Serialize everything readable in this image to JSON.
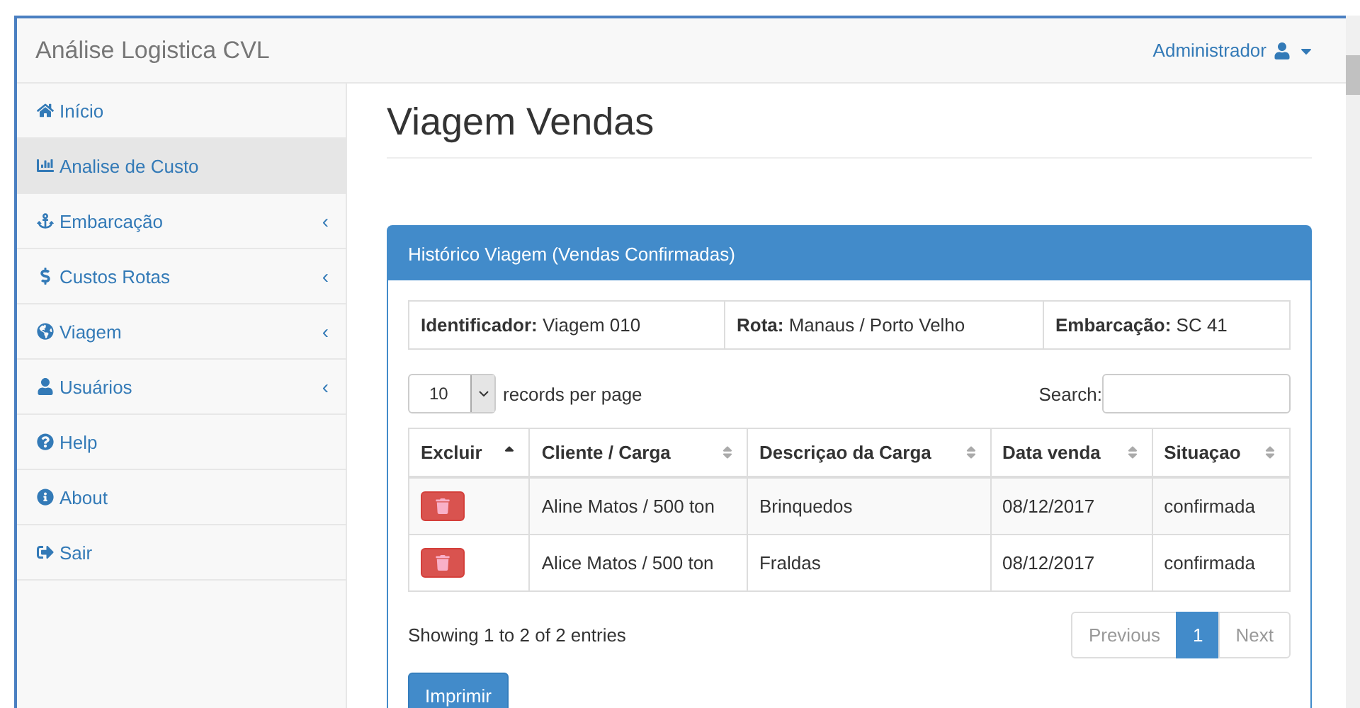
{
  "navbar": {
    "brand": "Análise Logistica CVL",
    "user": "Administrador"
  },
  "sidebar": {
    "items": [
      {
        "label": "Início",
        "selected": false
      },
      {
        "label": "Analise de Custo",
        "selected": true
      },
      {
        "label": "Embarcação",
        "selected": false,
        "caret": "‹"
      },
      {
        "label": "Custos Rotas",
        "selected": false,
        "caret": "‹"
      },
      {
        "label": "Viagem",
        "selected": false,
        "caret": "‹"
      },
      {
        "label": "Usuários",
        "selected": false,
        "caret": "‹"
      },
      {
        "label": "Help",
        "selected": false
      },
      {
        "label": "About",
        "selected": false
      },
      {
        "label": "Sair",
        "selected": false
      }
    ]
  },
  "page_title": "Viagem Vendas",
  "panel": {
    "heading": "Histórico Viagem (Vendas Confirmadas)",
    "summary": [
      {
        "label": "Identificador:",
        "value": "Viagem 010"
      },
      {
        "label": "Rota:",
        "value": "Manaus / Porto Velho"
      },
      {
        "label": "Embarcação:",
        "value": "SC 41"
      }
    ],
    "page_size": {
      "value": "10",
      "label": "records per page"
    },
    "search": {
      "label": "Search:"
    },
    "table": {
      "columns": [
        {
          "label": "Excluir",
          "sorted": true
        },
        {
          "label": "Cliente / Carga",
          "sorted": false
        },
        {
          "label": "Descriçao da Carga",
          "sorted": false
        },
        {
          "label": "Data venda",
          "sorted": false
        },
        {
          "label": "Situaçao",
          "sorted": false
        }
      ],
      "rows": [
        {
          "cells": [
            "",
            "Aline Matos / 500 ton",
            "Brinquedos",
            "08/12/2017",
            "confirmada"
          ]
        },
        {
          "cells": [
            "",
            "Alice Matos / 500 ton",
            "Fraldas",
            "08/12/2017",
            "confirmada"
          ]
        }
      ]
    },
    "info": "Showing 1 to 2 of 2 entries",
    "pagination": [
      {
        "label": "Previous",
        "selected": false,
        "disabled": true
      },
      {
        "label": "1",
        "selected": true,
        "disabled": false
      },
      {
        "label": "Next",
        "selected": false,
        "disabled": true
      }
    ],
    "print_button": "Imprimir"
  }
}
